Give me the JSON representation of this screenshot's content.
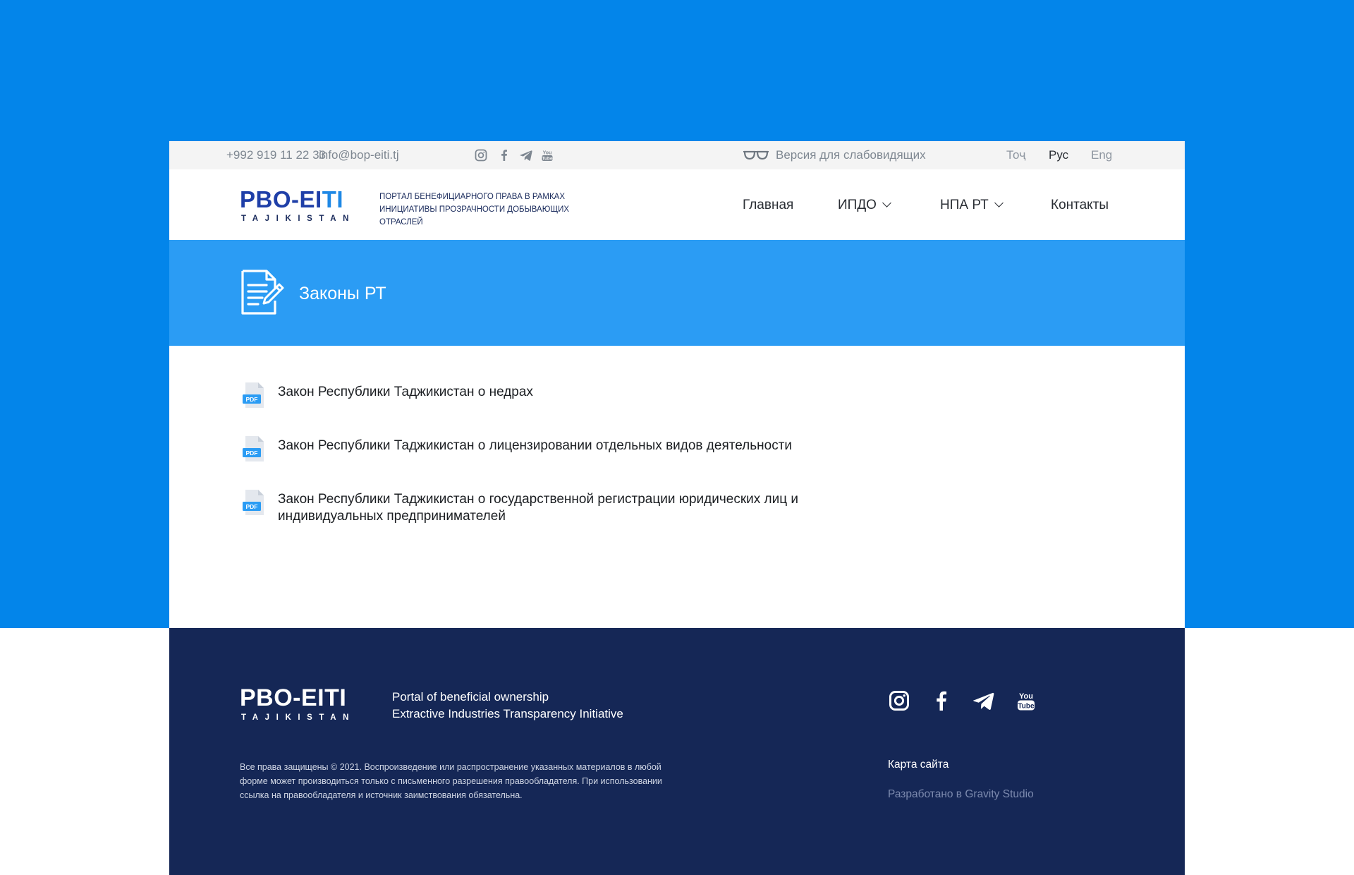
{
  "topbar": {
    "phone": "+992 919 11 22 33",
    "email": "info@bop-eiti.tj",
    "social_icons": [
      "instagram-icon",
      "facebook-icon",
      "telegram-icon",
      "youtube-icon"
    ],
    "accessibility_label": "Версия для слабовидящих",
    "languages": [
      {
        "label": "Тоҷ",
        "active": false
      },
      {
        "label": "Рус",
        "active": true
      },
      {
        "label": "Eng",
        "active": false
      }
    ]
  },
  "header": {
    "logo_main": "PBO-EI",
    "logo_accent": "TI",
    "logo_sub": "TAJIKISTAN",
    "tagline": "Портал бенефициарного права в рамках инициативы прозрачности добывающих отраслей",
    "nav": [
      {
        "label": "Главная",
        "has_dropdown": false
      },
      {
        "label": "ИПДО",
        "has_dropdown": true
      },
      {
        "label": "НПА РТ",
        "has_dropdown": true
      },
      {
        "label": "Контакты",
        "has_dropdown": false
      }
    ]
  },
  "banner": {
    "title": "Законы РТ",
    "icon": "document-edit-icon"
  },
  "documents": [
    {
      "title": "Закон Республики Таджикистан о недрах",
      "file_type": "PDF"
    },
    {
      "title": "Закон Республики Таджикистан о лицензировании отдельных видов деятельности",
      "file_type": "PDF"
    },
    {
      "title": "Закон Республики Таджикистан о государственной регистрации юридических лиц и индивидуальных предпринимателей",
      "file_type": "PDF"
    }
  ],
  "footer": {
    "logo": "PBO-EITI",
    "logo_sub": "TAJIKISTAN",
    "tagline_line1": "Portal of beneficial ownership",
    "tagline_line2": "Extractive Industries Transparency Initiative",
    "copyright": "Все права защищены © 2021. Воспроизведение или распространение указанных материалов в любой форме может производиться только с письменного разрешения правообладателя. При использовании ссылка на правообладателя и источник заимствования обязательна.",
    "sitemap_label": "Карта сайта",
    "developer_label": "Разработано в Gravity Studio",
    "social_icons": [
      "instagram-icon",
      "facebook-icon",
      "telegram-icon",
      "youtube-icon"
    ]
  },
  "colors": {
    "page_background": "#0385EA",
    "banner": "#2B9CF4",
    "footer": "#152756",
    "logo_primary": "#1F3FA8",
    "logo_accent": "#1E88E5"
  }
}
